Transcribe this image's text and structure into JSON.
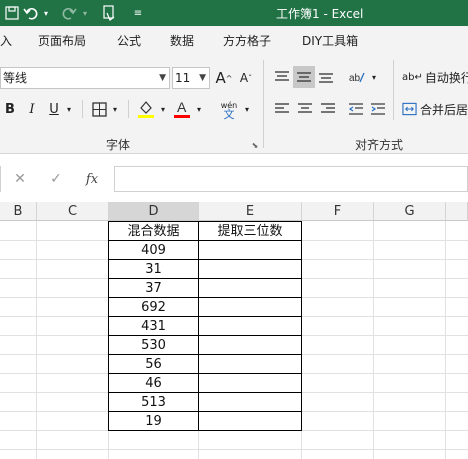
{
  "title_bar": {
    "document_title": "工作簿1  -  Excel",
    "icons": [
      "save-icon",
      "undo-icon",
      "redo-icon",
      "touch-mode-icon",
      "customize-qat-icon"
    ]
  },
  "ribbon_tabs": [
    "入",
    "页面布局",
    "公式",
    "数据",
    "方方格子",
    "DIY工具箱"
  ],
  "font_group": {
    "font_name": "等线",
    "font_size": "11",
    "bold": "B",
    "italic": "I",
    "underline": "U",
    "phonetic": "wén",
    "label": "字体"
  },
  "alignment_group": {
    "wrap_text": "自动换行",
    "merge_center": "合并后居",
    "label": "对齐方式"
  },
  "formula_bar": {
    "cancel": "✕",
    "enter": "✓",
    "fx": "fx",
    "content": ""
  },
  "sheet": {
    "columns": [
      "B",
      "C",
      "D",
      "E",
      "F",
      "G"
    ],
    "selected_column": "D",
    "header_row": [
      "混合数据",
      "提取三位数"
    ],
    "values": [
      "409",
      "31",
      "37",
      "692",
      "431",
      "530",
      "56",
      "46",
      "513",
      "19"
    ]
  },
  "colors": {
    "title_bar": "#217346",
    "ribbon_bg": "#f3f3f3",
    "highlight_yellow": "#ffff00",
    "font_red": "#ff0000"
  }
}
